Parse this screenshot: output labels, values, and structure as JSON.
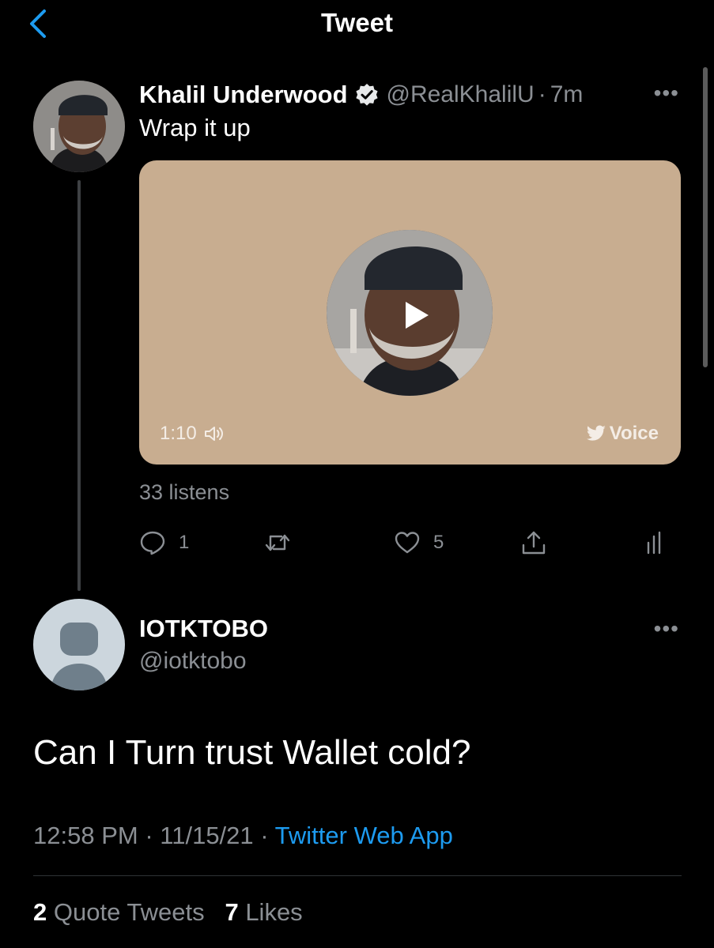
{
  "header": {
    "title": "Tweet"
  },
  "tweet": {
    "author_name": "Khalil Underwood",
    "handle": "@RealKhalilU",
    "separator": "·",
    "time": "7m",
    "text": "Wrap it up",
    "voice": {
      "duration": "1:10",
      "label": "Voice",
      "card_color": "#c8ad90"
    },
    "listens": "33 listens",
    "actions": {
      "reply_count": "1",
      "retweet_count": "",
      "like_count": "5"
    }
  },
  "reply": {
    "author_name": "IOTKTOBO",
    "handle": "@iotktobo",
    "text": "Can I Turn trust Wallet cold?",
    "time": "12:58 PM",
    "separator": "·",
    "date": "11/15/21",
    "source": "Twitter Web App",
    "quote_count": "2",
    "quote_label": "Quote Tweets",
    "like_count": "7",
    "like_label": "Likes"
  },
  "colors": {
    "accent": "#1d9bf0",
    "background": "#000000",
    "muted": "#8b8f94"
  },
  "icons": [
    "back-chevron-icon",
    "verified-badge-icon",
    "more-icon",
    "play-icon",
    "speaker-icon",
    "twitter-bird-icon",
    "reply-icon",
    "retweet-icon",
    "like-icon",
    "share-icon",
    "analytics-icon",
    "default-avatar-icon"
  ]
}
